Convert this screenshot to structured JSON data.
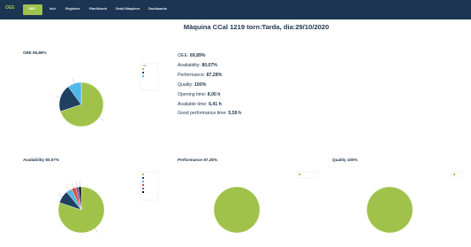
{
  "navbar": {
    "brand": "OEE",
    "items": [
      "OEE",
      "Inici",
      "Registres",
      "Planificació",
      "Detall Màquines",
      "Dashboards"
    ]
  },
  "page_title": "Màquina CCal 1219 torn:Tarda, dia:29/10/2020",
  "stats": [
    {
      "label": "OEE:",
      "value": "69,89%"
    },
    {
      "label": "Availability:",
      "value": "80,07%"
    },
    {
      "label": "Performance:",
      "value": "87,28%"
    },
    {
      "label": "Quality:",
      "value": "100%"
    },
    {
      "label": "Opening time:",
      "value": "8,00 h"
    },
    {
      "label": "Available time:",
      "value": "6,41 h"
    },
    {
      "label": "Good performance time:",
      "value": "5,59 h"
    }
  ],
  "colors": {
    "navbar": "#1c3553",
    "accent": "#9fc24c",
    "green": "#a0c24a",
    "navy": "#1f4060",
    "cyan": "#4fb8e8",
    "red": "#d94c3a",
    "grey": "#9aa0a6",
    "black": "#111111",
    "purple": "#7a5aa0"
  },
  "chart_data": [
    {
      "type": "pie",
      "title": "OEE 69,89%",
      "legend_title": "OEE",
      "values": [
        69.89,
        20,
        10.11
      ],
      "colors": [
        "#a0c24a",
        "#1f4060",
        "#4fb8e8"
      ]
    },
    {
      "type": "pie",
      "title": "Availability 80,07%",
      "values": [
        80.07,
        9,
        4,
        3,
        2,
        1.93
      ],
      "colors": [
        "#a0c24a",
        "#1f4060",
        "#4fb8e8",
        "#d94c3a",
        "#7a5aa0",
        "#111111"
      ]
    },
    {
      "type": "pie",
      "title": "Performance 87,28%",
      "values": [
        100
      ],
      "colors": [
        "#a0c24a"
      ]
    },
    {
      "type": "pie",
      "title": "Quality 100%",
      "values": [
        100
      ],
      "colors": [
        "#a0c24a"
      ]
    }
  ]
}
